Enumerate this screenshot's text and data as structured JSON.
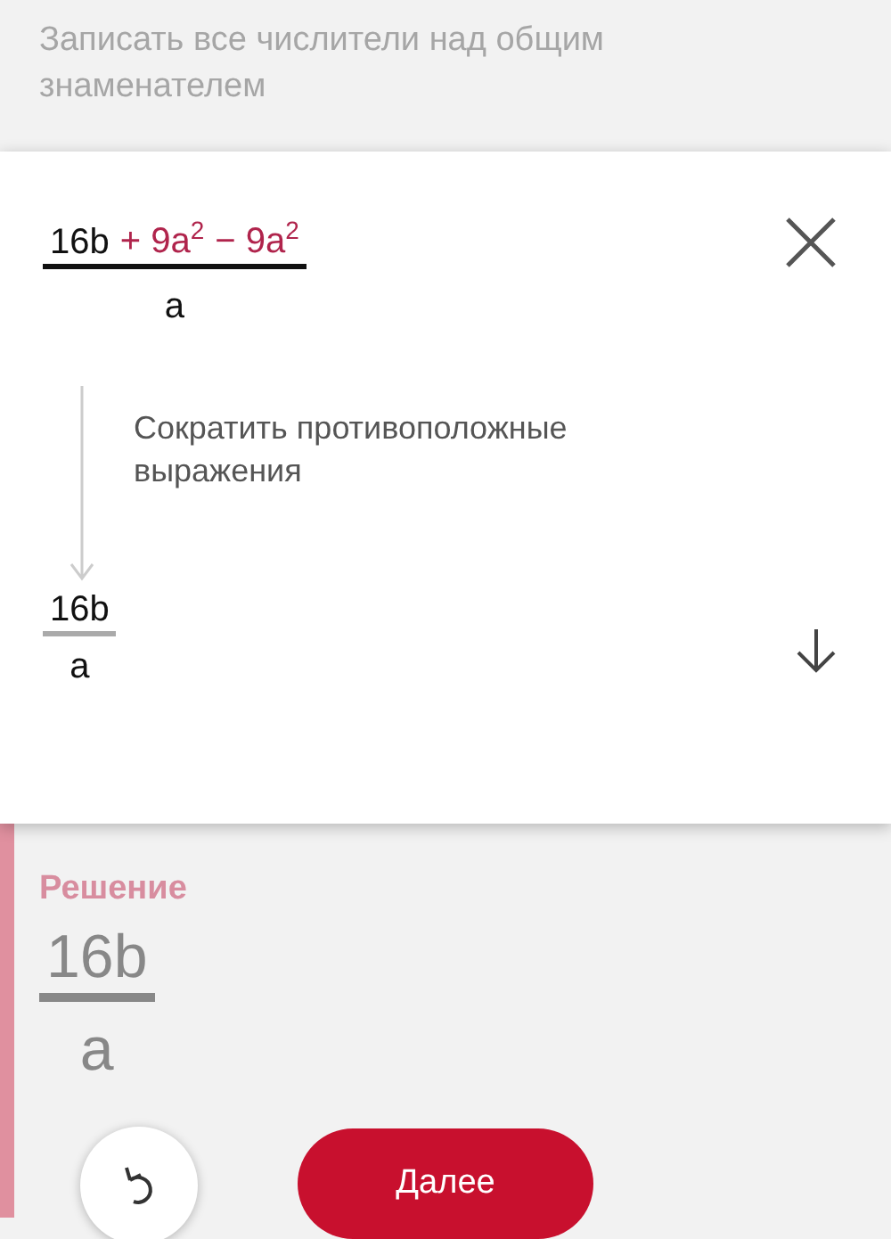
{
  "previous_step": {
    "text": "Записать все числители над общим знаменателем"
  },
  "step_card": {
    "expression": {
      "numerator": [
        {
          "text": "16b",
          "highlighted": false
        },
        {
          "text": "+ 9a$^{2}$",
          "highlighted": true
        },
        {
          "text": "− 9a$^{2}$",
          "highlighted": true
        }
      ],
      "denominator": "a"
    },
    "explanation": "Сократить противоположные выражения",
    "result": {
      "numerator": "16b",
      "denominator": "a"
    }
  },
  "solution": {
    "title": "Решение",
    "numerator": "16b",
    "denominator": "a"
  },
  "buttons": {
    "next": "Далее"
  }
}
